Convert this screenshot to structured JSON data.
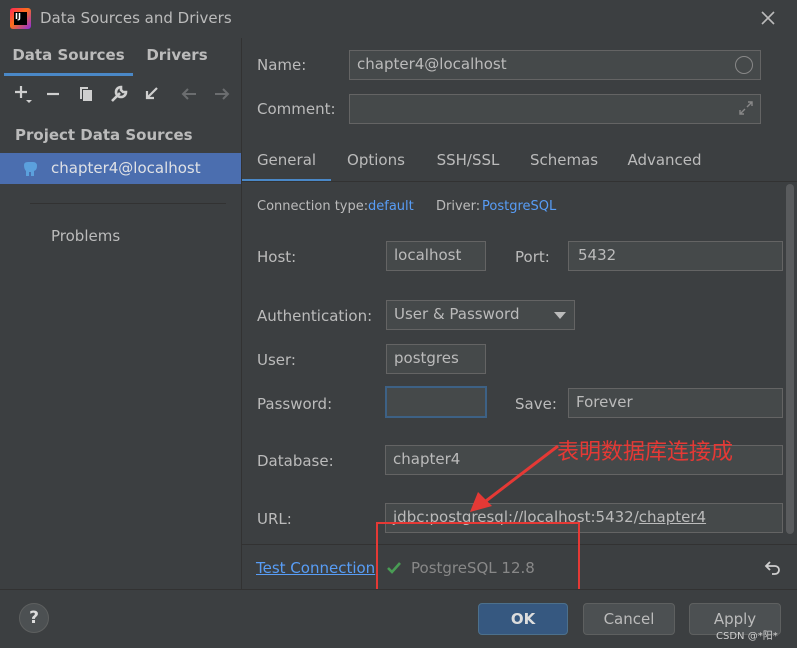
{
  "window": {
    "title": "Data Sources and Drivers",
    "close_icon": "close-icon",
    "logo_letters": "IJ"
  },
  "left": {
    "tabs": [
      {
        "label": "Data Sources",
        "active": true
      },
      {
        "label": "Drivers",
        "active": false
      }
    ],
    "toolbar": [
      "add-icon",
      "remove-icon",
      "copy-icon",
      "wrench-icon",
      "import-icon",
      "back-arrow-icon",
      "forward-arrow-icon"
    ],
    "section_header": "Project Data Sources",
    "datasource": {
      "label": "chapter4@localhost",
      "icon": "postgresql-elephant-icon"
    },
    "problems": "Problems"
  },
  "form": {
    "name_label": "Name:",
    "name_value": "chapter4@localhost",
    "comment_label": "Comment:",
    "comment_value": ""
  },
  "tabs": [
    "General",
    "Options",
    "SSH/SSL",
    "Schemas",
    "Advanced"
  ],
  "general": {
    "connection_type_label": "Connection type:",
    "connection_type_value": "default",
    "driver_label": "Driver:",
    "driver_value": "PostgreSQL",
    "host_label": "Host:",
    "host_value": "localhost",
    "port_label": "Port:",
    "port_value": "5432",
    "auth_label": "Authentication:",
    "auth_value": "User & Password",
    "user_label": "User:",
    "user_value": "postgres",
    "password_label": "Password:",
    "password_value": "",
    "save_label": "Save:",
    "save_value": "Forever",
    "database_label": "Database:",
    "database_value": "chapter4",
    "url_label": "URL:",
    "url_prefix": "jdbc:postgresql://localhost:5432/",
    "url_db": "chapter4"
  },
  "bottom": {
    "test_connection": "Test Connection",
    "status": "PostgreSQL 12.8",
    "check_icon": "check-icon",
    "undo_icon": "undo-icon"
  },
  "annotation": {
    "text": "表明数据库连接成",
    "color": "#e53935"
  },
  "footer": {
    "help": "?",
    "ok": "OK",
    "cancel": "Cancel",
    "apply": "Apply"
  },
  "watermark": "CSDN @*阳*",
  "colors": {
    "accent": "#4a88c7",
    "selection": "#4b6eaf",
    "link": "#589df6",
    "success": "#499c54",
    "ok_button": "#365880"
  }
}
